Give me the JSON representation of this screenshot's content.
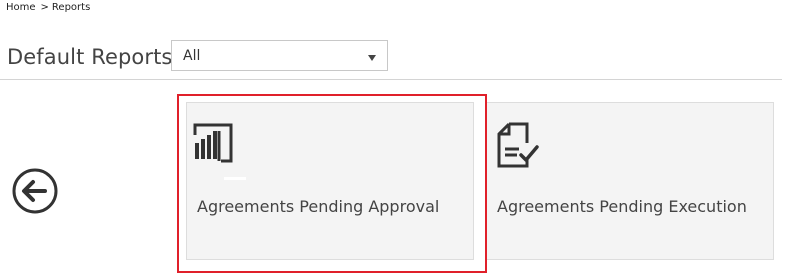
{
  "breadcrumb": {
    "home": "Home",
    "separator": ">",
    "current": "Reports"
  },
  "header": {
    "title": "Default Reports",
    "filter": {
      "selected": "All"
    }
  },
  "navigation": {
    "back_icon": "arrow-left-circle-icon"
  },
  "tiles": [
    {
      "label": "Agreements Pending Approval",
      "icon": "power-bi-icon",
      "highlighted": true
    },
    {
      "label": "Agreements Pending Execution",
      "icon": "document-check-icon",
      "highlighted": false
    }
  ],
  "colors": {
    "highlight": "#e0202a",
    "tile_bg": "#f4f4f4",
    "icon": "#333333"
  }
}
